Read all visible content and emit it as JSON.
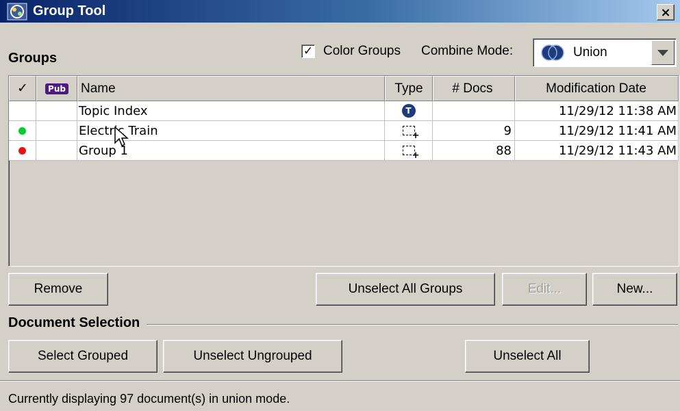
{
  "window": {
    "title": "Group Tool",
    "close_label": "×"
  },
  "groups": {
    "label": "Groups",
    "color_groups_label": "Color Groups",
    "color_groups_checked": "✓",
    "combine_mode_label": "Combine Mode:",
    "combine_mode_value": "Union"
  },
  "table": {
    "headers": {
      "check": "✓",
      "pub": "Pub",
      "name": "Name",
      "type": "Type",
      "docs": "# Docs",
      "date": "Modification Date"
    },
    "rows": [
      {
        "status_color": "",
        "name": "Topic Index",
        "type_icon": "topic-index-icon",
        "docs": "",
        "date": "11/29/12 11:38 AM"
      },
      {
        "status_color": "#00cc33",
        "name": "Electric Train",
        "type_icon": "group-icon",
        "docs": "9",
        "date": "11/29/12 11:41 AM"
      },
      {
        "status_color": "#ee1111",
        "name": "Group 1",
        "type_icon": "group-icon",
        "docs": "88",
        "date": "11/29/12 11:43 AM"
      }
    ]
  },
  "buttons": {
    "remove": "Remove",
    "unselect_all_groups": "Unselect All Groups",
    "edit": "Edit...",
    "new": "New..."
  },
  "document_selection": {
    "label": "Document Selection",
    "select_grouped": "Select Grouped",
    "unselect_ungrouped": "Unselect Ungrouped",
    "unselect_all": "Unselect All"
  },
  "status": {
    "text": "Currently displaying 97 document(s) in union mode."
  }
}
